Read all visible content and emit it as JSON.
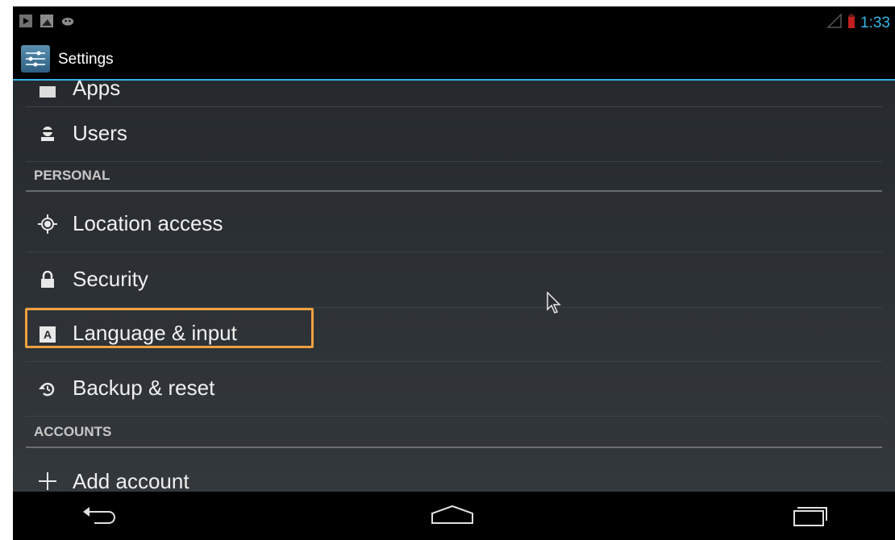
{
  "status_bar": {
    "time": "1:33",
    "icons": [
      "play-store-icon",
      "screenshot-icon",
      "android-debug-icon",
      "signal-icon",
      "battery-low-icon"
    ],
    "accent": "#33b5e5"
  },
  "action_bar": {
    "title": "Settings",
    "icon": "settings-app-icon"
  },
  "list": {
    "partial_item": "Apps",
    "items_top": [
      {
        "label": "Users",
        "icon": "user-icon"
      }
    ],
    "personal_header": "PERSONAL",
    "personal_items": [
      {
        "label": "Location access",
        "icon": "location-icon"
      },
      {
        "label": "Security",
        "icon": "lock-icon"
      },
      {
        "label": "Language & input",
        "icon": "language-icon",
        "highlighted": true
      },
      {
        "label": "Backup & reset",
        "icon": "backup-icon"
      }
    ],
    "accounts_header": "ACCOUNTS",
    "accounts_items": [
      {
        "label": "Add account",
        "icon": "plus-icon"
      }
    ]
  },
  "highlight_color": "#f0a040",
  "nav_bar": {
    "buttons": [
      "back-icon",
      "home-icon",
      "recent-apps-icon"
    ]
  }
}
